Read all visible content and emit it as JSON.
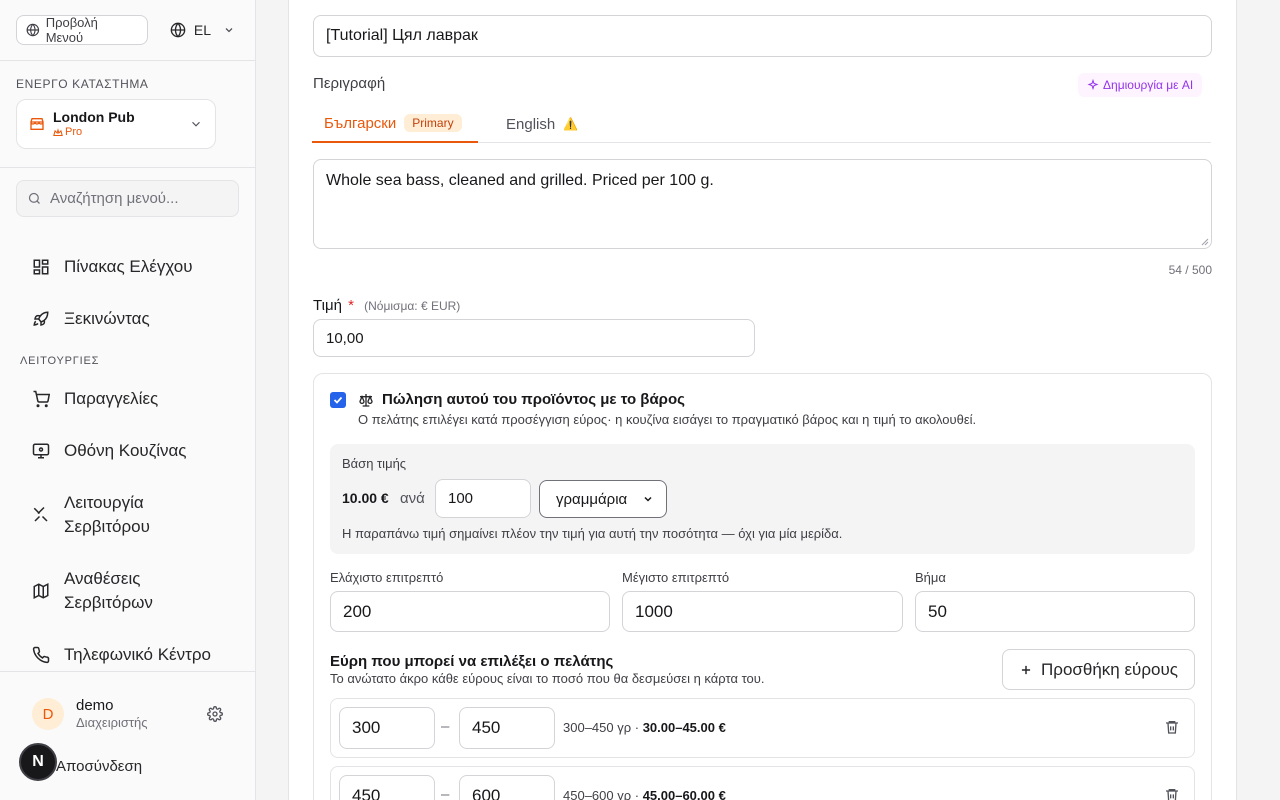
{
  "sidebar": {
    "view_menu": "Προβολή Μενού",
    "lang": "EL",
    "active_store_caption": "ΕΝΕΡΓΟ ΚΑΤΑΣΤΗΜΑ",
    "store_name": "London Pub",
    "store_tier": "Pro",
    "search_placeholder": "Αναζήτηση μενού...",
    "nav_top": [
      {
        "label": "Πίνακας Ελέγχου",
        "icon": "dashboard-icon"
      },
      {
        "label": "Ξεκινώντας",
        "icon": "rocket-icon"
      }
    ],
    "section_label": "ΛΕΙΤΟΥΡΓΙΕΣ",
    "nav_ops": [
      {
        "label": "Παραγγελίες",
        "icon": "cart-icon"
      },
      {
        "label": "Οθόνη Κουζίνας",
        "icon": "monitor-icon"
      },
      {
        "label": "Λειτουργία Σερβιτόρου",
        "icon": "utensils-icon"
      },
      {
        "label": "Αναθέσεις Σερβιτόρων",
        "icon": "map-icon"
      },
      {
        "label": "Τηλεφωνικό Κέντρο",
        "icon": "phone-icon"
      }
    ],
    "user": {
      "initial": "D",
      "name": "demo",
      "role": "Διαχειριστής"
    },
    "logout": "Αποσύνδεση",
    "n_badge": "N"
  },
  "form": {
    "name_value": "[Tutorial] Цял лаврак",
    "description_label": "Περιγραφή",
    "ai_button": "Δημιουργία με AI",
    "tabs": [
      {
        "label": "Български",
        "badge": "Primary"
      },
      {
        "label": "English",
        "badge": "⚠️"
      }
    ],
    "description_value": "Whole sea bass, cleaned and grilled. Priced per 100 g.",
    "char_counter": "54 / 500",
    "price_label": "Τιμή",
    "price_required": "*",
    "price_currency_note": "(Νόμισμα: € EUR)",
    "price_value": "10,00"
  },
  "weight": {
    "checked": true,
    "title": "Πώληση αυτού του προϊόντος με το βάρος",
    "description": "Ο πελάτης επιλέγει κατά προσέγγιση εύρος· η κουζίνα εισάγει το πραγματικό βάρος και η τιμή το ακολουθεί.",
    "price_basis_caption": "Βάση τιμής",
    "price_basis_price": "10.00 €",
    "price_basis_per": "ανά",
    "price_basis_qty": "100",
    "price_basis_unit": "γραμμάρια",
    "price_basis_note": "Η παραπάνω τιμή σημαίνει πλέον την τιμή για αυτή την ποσότητα — όχι για μία μερίδα.",
    "min_label": "Ελάχιστο επιτρεπτό",
    "min_value": "200",
    "max_label": "Μέγιστο επιτρεπτό",
    "max_value": "1000",
    "step_label": "Βήμα",
    "step_value": "50",
    "ranges_title": "Εύρη που μπορεί να επιλέξει ο πελάτης",
    "ranges_desc": "Το ανώτατο άκρο κάθε εύρους είναι το ποσό που θα δεσμεύσει η κάρτα του.",
    "add_range": "Προσθήκη εύρους",
    "ranges": [
      {
        "from": "300",
        "to": "450",
        "summary": "300–450 γρ ·",
        "price": "30.00–45.00 €"
      },
      {
        "from": "450",
        "to": "600",
        "summary": "450–600 γρ ·",
        "price": "45.00–60.00 €"
      }
    ]
  }
}
